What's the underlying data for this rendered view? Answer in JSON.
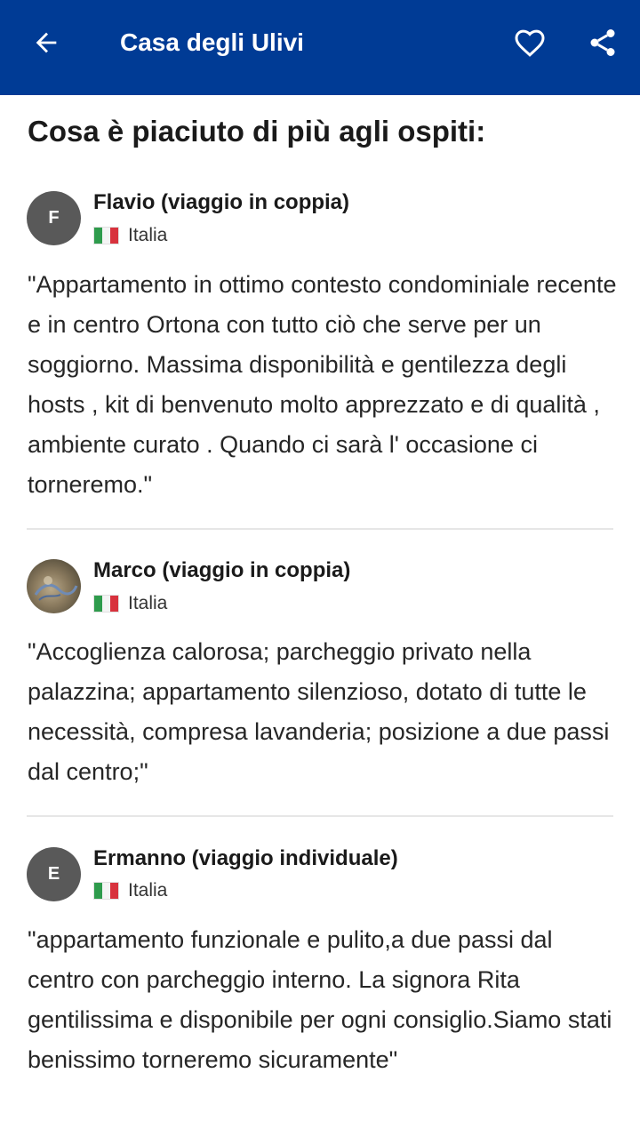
{
  "appbar": {
    "title": "Casa degli Ulivi",
    "back_icon": "arrow-left-icon",
    "favorite_icon": "heart-outline-icon",
    "share_icon": "share-icon",
    "background_color": "#003b95"
  },
  "heading": "Cosa è piaciuto di più agli ospiti:",
  "reviews": [
    {
      "avatar_letter": "F",
      "name": "Flavio (viaggio in coppia)",
      "country": "Italia",
      "text": "\"Appartamento in ottimo contesto condominiale recente e in centro Ortona con tutto ciò che serve per un soggiorno. Massima disponibilità e gentilezza degli hosts , kit di benvenuto molto apprezzato e di qualità , ambiente curato . Quando ci sarà l' occasione ci torneremo.\""
    },
    {
      "avatar_letter": "",
      "name": "Marco (viaggio in coppia)",
      "country": "Italia",
      "text": "\"Accoglienza calorosa; parcheggio privato nella palazzina; appartamento silenzioso, dotato di tutte le necessità, compresa lavanderia; posizione a due passi dal centro;\""
    },
    {
      "avatar_letter": "E",
      "name": "Ermanno (viaggio individuale)",
      "country": "Italia",
      "text": "\"appartamento funzionale e pulito,a due passi dal centro con parcheggio interno. La signora Rita gentilissima e disponibile per ogni consiglio.Siamo stati benissimo torneremo sicuramente\""
    }
  ]
}
